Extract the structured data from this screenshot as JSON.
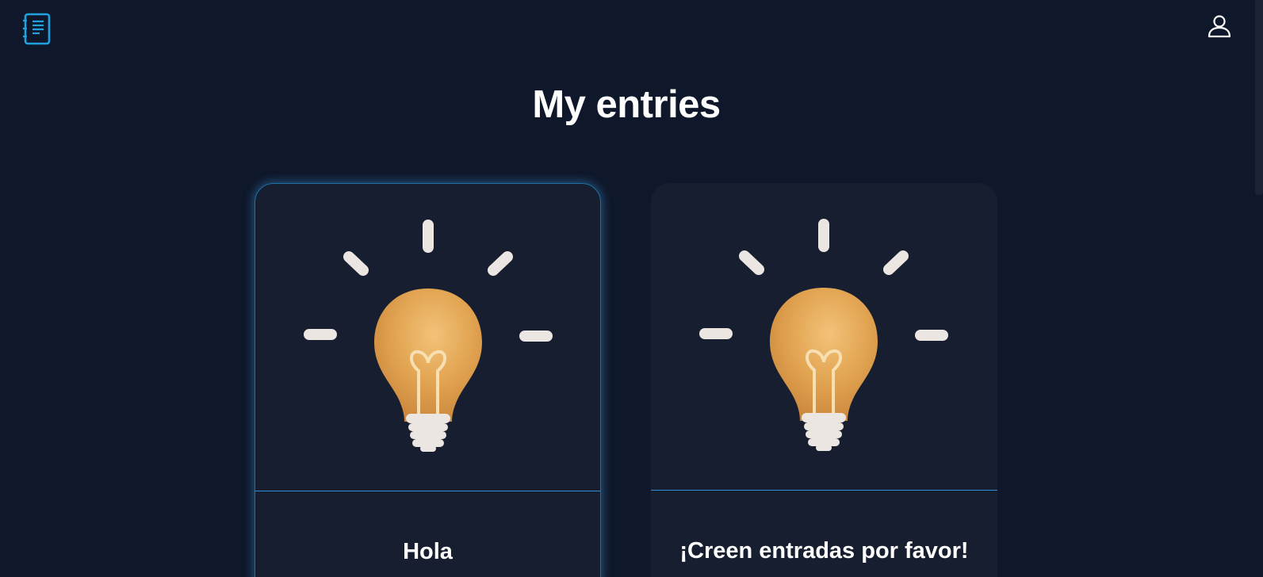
{
  "header": {
    "logo_icon": "journal-list-icon",
    "user_icon": "user-icon",
    "accent_color": "#1fa3e0"
  },
  "main": {
    "title": "My entries"
  },
  "entries": [
    {
      "title": "Hola",
      "image_icon": "lightbulb-icon",
      "active": true
    },
    {
      "title": "¡Creen entradas por favor!",
      "image_icon": "lightbulb-icon",
      "active": false
    }
  ]
}
